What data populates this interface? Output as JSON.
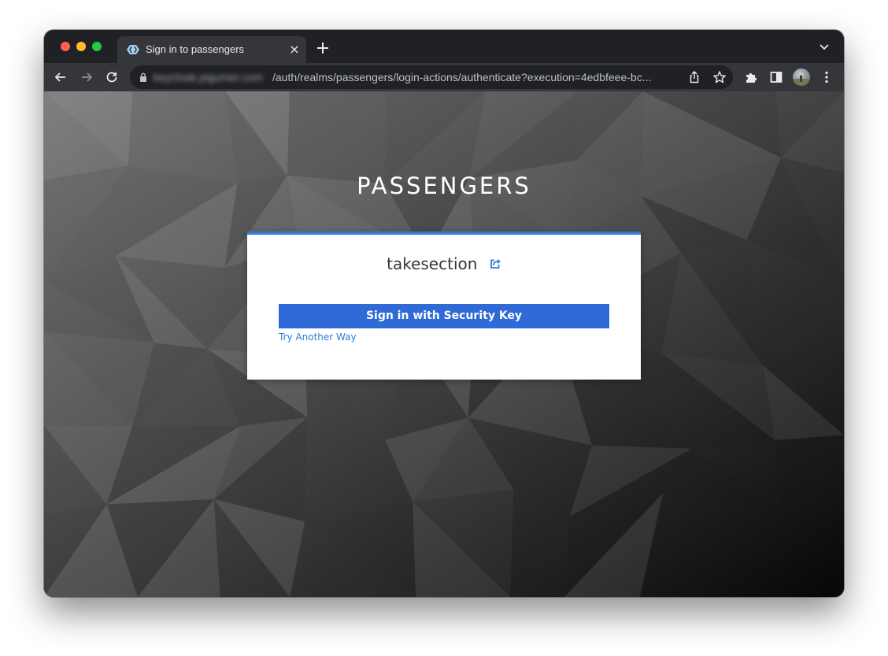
{
  "browser": {
    "tab": {
      "title": "Sign in to passengers",
      "close_glyph": "×",
      "favicon": "keycloak-favicon-icon"
    },
    "new_tab_icon": "plus-icon",
    "tab_menu_icon": "chevron-down-icon",
    "toolbar": {
      "back_icon": "arrow-left-icon",
      "forward_icon": "arrow-right-icon",
      "reload_icon": "reload-icon",
      "extensions_icon": "puzzle-icon",
      "side_panel_icon": "side-panel-icon",
      "menu_icon": "kebab-menu-icon"
    },
    "omnibox": {
      "host": "keycloak.pigumer.com",
      "path": "/auth/realms/passengers/login-actions/authenticate?execution=4edbfeee-bc...",
      "lock_icon": "lock-icon",
      "share_icon": "share-icon",
      "bookmark_icon": "star-icon"
    }
  },
  "page": {
    "realm_title": "PASSENGERS",
    "username": "takesection",
    "restart_login_icon": "external-link-icon",
    "primary_button": "Sign in with Security Key",
    "alternative_link": "Try Another Way",
    "accent_color": "#3a7bd5",
    "button_color": "#2f6ad7",
    "link_color": "#2d7fd4"
  }
}
